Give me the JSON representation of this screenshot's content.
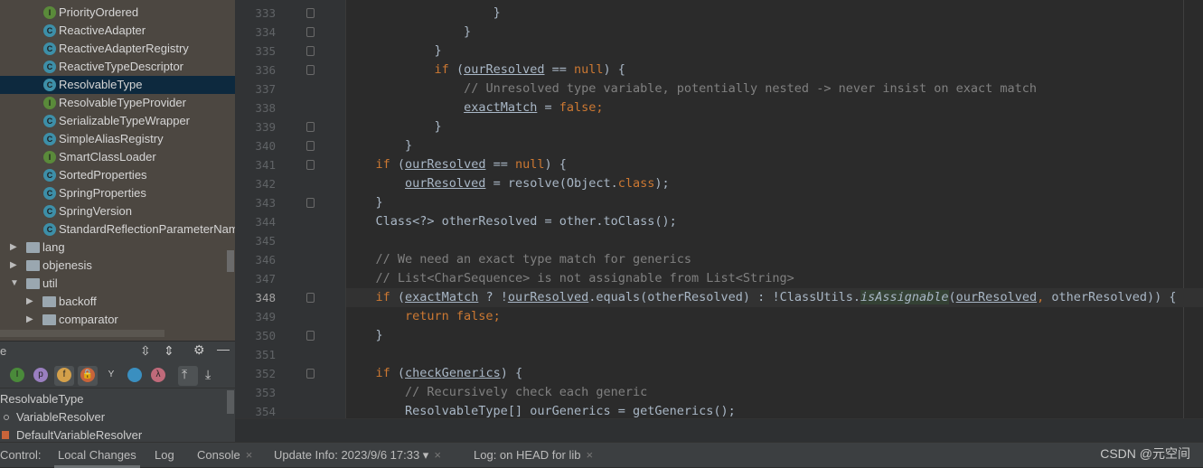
{
  "project_tree": {
    "classes": [
      {
        "label": "PriorityOrdered",
        "kind": "interface"
      },
      {
        "label": "ReactiveAdapter",
        "kind": "class"
      },
      {
        "label": "ReactiveAdapterRegistry",
        "kind": "class"
      },
      {
        "label": "ReactiveTypeDescriptor",
        "kind": "class"
      },
      {
        "label": "ResolvableType",
        "kind": "class",
        "selected": true
      },
      {
        "label": "ResolvableTypeProvider",
        "kind": "interface"
      },
      {
        "label": "SerializableTypeWrapper",
        "kind": "class"
      },
      {
        "label": "SimpleAliasRegistry",
        "kind": "class"
      },
      {
        "label": "SmartClassLoader",
        "kind": "interface"
      },
      {
        "label": "SortedProperties",
        "kind": "class"
      },
      {
        "label": "SpringProperties",
        "kind": "class"
      },
      {
        "label": "SpringVersion",
        "kind": "class"
      },
      {
        "label": "StandardReflectionParameterNam",
        "kind": "class"
      }
    ],
    "packages": [
      {
        "label": "lang",
        "expanded": false,
        "depth": 0
      },
      {
        "label": "objenesis",
        "expanded": false,
        "depth": 0
      },
      {
        "label": "util",
        "expanded": true,
        "depth": 0
      },
      {
        "label": "backoff",
        "expanded": false,
        "depth": 1
      },
      {
        "label": "comparator",
        "expanded": false,
        "depth": 1
      }
    ]
  },
  "structure": {
    "title": "e",
    "items": [
      {
        "label": "ResolvableType",
        "icon": "none"
      },
      {
        "label": "VariableResolver",
        "icon": "dot-icon"
      },
      {
        "label": "DefaultVariableResolver",
        "icon": "lock-icon"
      }
    ],
    "filter_icons": [
      {
        "name": "inherited-icon",
        "glyph": "I",
        "color": "#4a8a3a"
      },
      {
        "name": "property-icon",
        "glyph": "p",
        "color": "#9a7fc0"
      },
      {
        "name": "field-icon",
        "glyph": "f",
        "color": "#d4a04a"
      },
      {
        "name": "lock-icon",
        "glyph": "🔒",
        "color": "#c8643a"
      },
      {
        "name": "anonymous-icon",
        "glyph": "Y",
        "color": "#cccccc"
      },
      {
        "name": "lambda-circle-icon",
        "glyph": "",
        "color": "#3a8fc0"
      },
      {
        "name": "lambda-icon",
        "glyph": "λ",
        "color": "#c06a7a"
      }
    ]
  },
  "editor": {
    "current_line": 348,
    "lines": [
      {
        "n": 333,
        "t": [
          [
            "            }",
            ""
          ]
        ]
      },
      {
        "n": 334,
        "t": [
          [
            "        }",
            ""
          ]
        ]
      },
      {
        "n": 335,
        "t": [
          [
            "    }",
            ""
          ]
        ]
      },
      {
        "n": 336,
        "t": [
          [
            "    ",
            ""
          ],
          [
            "if",
            "kw"
          ],
          [
            " (",
            ""
          ],
          [
            "ourResolved",
            "u"
          ],
          [
            " == ",
            ""
          ],
          [
            "null",
            "kw"
          ],
          [
            ") {",
            ""
          ]
        ]
      },
      {
        "n": 337,
        "t": [
          [
            "        ",
            ""
          ],
          [
            "// Unresolved type variable, potentially nested -> never insist on exact match",
            "cm"
          ]
        ]
      },
      {
        "n": 338,
        "t": [
          [
            "        ",
            ""
          ],
          [
            "exactMatch",
            "u"
          ],
          [
            " = ",
            ""
          ],
          [
            "false",
            "kw"
          ],
          [
            ";",
            "kw"
          ]
        ]
      },
      {
        "n": 339,
        "t": [
          [
            "    }",
            ""
          ]
        ]
      },
      {
        "n": 340,
        "t": [
          [
            "}",
            ""
          ]
        ]
      },
      {
        "n": 341,
        "t": [
          [
            "if",
            "kw"
          ],
          [
            " (",
            ""
          ],
          [
            "ourResolved",
            "u"
          ],
          [
            " == ",
            ""
          ],
          [
            "null",
            "kw"
          ],
          [
            ") {",
            ""
          ]
        ]
      },
      {
        "n": 342,
        "t": [
          [
            "    ",
            ""
          ],
          [
            "ourResolved",
            "u"
          ],
          [
            " = resolve(Object.",
            ""
          ],
          [
            "class",
            "kw"
          ],
          [
            ");",
            ""
          ]
        ]
      },
      {
        "n": 343,
        "t": [
          [
            "}",
            ""
          ]
        ]
      },
      {
        "n": 344,
        "t": [
          [
            "Class<?> otherResolved = other.toClass();",
            ""
          ]
        ]
      },
      {
        "n": 345,
        "t": []
      },
      {
        "n": 346,
        "t": [
          [
            "// We need an exact type match for generics",
            "cm"
          ]
        ]
      },
      {
        "n": 347,
        "t": [
          [
            "// List<CharSequence> is not assignable from List<String>",
            "cm"
          ]
        ]
      },
      {
        "n": 348,
        "t": [
          [
            "if",
            "kw"
          ],
          [
            " (",
            ""
          ],
          [
            "exactMatch",
            "u"
          ],
          [
            " ? !",
            ""
          ],
          [
            "ourResolved",
            "u"
          ],
          [
            ".equals(otherResolved) : !ClassUtils.",
            ""
          ],
          [
            "isAssignable",
            "it"
          ],
          [
            "(",
            ""
          ],
          [
            "ourResolved",
            "u"
          ],
          [
            ", ",
            "kw"
          ],
          [
            "otherResolved)) {",
            ""
          ]
        ]
      },
      {
        "n": 349,
        "t": [
          [
            "    ",
            ""
          ],
          [
            "return false;",
            "kw"
          ]
        ]
      },
      {
        "n": 350,
        "t": [
          [
            "}",
            ""
          ]
        ]
      },
      {
        "n": 351,
        "t": []
      },
      {
        "n": 352,
        "t": [
          [
            "if",
            "kw"
          ],
          [
            " (",
            ""
          ],
          [
            "checkGenerics",
            "u"
          ],
          [
            ") {",
            ""
          ]
        ]
      },
      {
        "n": 353,
        "t": [
          [
            "    ",
            ""
          ],
          [
            "// Recursively check each generic",
            "cm"
          ]
        ]
      },
      {
        "n": 354,
        "t": [
          [
            "    ResolvableType[] ourGenerics = getGenerics();",
            ""
          ]
        ]
      }
    ]
  },
  "bottom_bar": {
    "tabs": [
      {
        "label": "Control:",
        "closable": false
      },
      {
        "label": "Local Changes",
        "closable": false,
        "active": true
      },
      {
        "label": "Log",
        "closable": false
      },
      {
        "label": "Console",
        "closable": true
      },
      {
        "label": "Update Info: 2023/9/6 17:33 ▾",
        "closable": true
      },
      {
        "label": "Log: on HEAD for lib",
        "closable": true
      }
    ],
    "watermark": "CSDN @元空间"
  }
}
